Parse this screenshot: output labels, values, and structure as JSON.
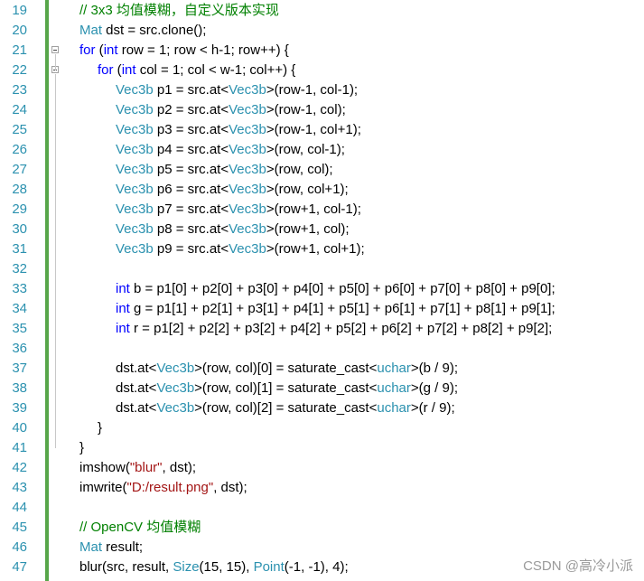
{
  "editor": {
    "watermark": "CSDN @高冷小派",
    "colors": {
      "line_number": "#2b91af",
      "keyword": "#0000ff",
      "type": "#2b91af",
      "comment": "#008000",
      "string": "#a31515",
      "change_bar": "#57a64a"
    },
    "lines": [
      {
        "n": "19",
        "indent": 1,
        "tokens": [
          [
            "cm",
            "// 3x3 均值模糊，自定义版本实现"
          ]
        ]
      },
      {
        "n": "20",
        "indent": 1,
        "tokens": [
          [
            "ty",
            "Mat"
          ],
          [
            "tx",
            " dst = src.clone();"
          ]
        ]
      },
      {
        "n": "21",
        "indent": 1,
        "fold": true,
        "tokens": [
          [
            "kw",
            "for"
          ],
          [
            "tx",
            " ("
          ],
          [
            "kw",
            "int"
          ],
          [
            "tx",
            " row = 1; row < h-1; row++) {"
          ]
        ]
      },
      {
        "n": "22",
        "indent": 2,
        "fold": true,
        "tokens": [
          [
            "kw",
            "for"
          ],
          [
            "tx",
            " ("
          ],
          [
            "kw",
            "int"
          ],
          [
            "tx",
            " col = 1; col < w-1; col++) {"
          ]
        ]
      },
      {
        "n": "23",
        "indent": 3,
        "tokens": [
          [
            "ty",
            "Vec3b"
          ],
          [
            "tx",
            " p1 = src.at<"
          ],
          [
            "ty",
            "Vec3b"
          ],
          [
            "tx",
            ">(row-1, col-1);"
          ]
        ]
      },
      {
        "n": "24",
        "indent": 3,
        "tokens": [
          [
            "ty",
            "Vec3b"
          ],
          [
            "tx",
            " p2 = src.at<"
          ],
          [
            "ty",
            "Vec3b"
          ],
          [
            "tx",
            ">(row-1, col);"
          ]
        ]
      },
      {
        "n": "25",
        "indent": 3,
        "tokens": [
          [
            "ty",
            "Vec3b"
          ],
          [
            "tx",
            " p3 = src.at<"
          ],
          [
            "ty",
            "Vec3b"
          ],
          [
            "tx",
            ">(row-1, col+1);"
          ]
        ]
      },
      {
        "n": "26",
        "indent": 3,
        "tokens": [
          [
            "ty",
            "Vec3b"
          ],
          [
            "tx",
            " p4 = src.at<"
          ],
          [
            "ty",
            "Vec3b"
          ],
          [
            "tx",
            ">(row, col-1);"
          ]
        ]
      },
      {
        "n": "27",
        "indent": 3,
        "tokens": [
          [
            "ty",
            "Vec3b"
          ],
          [
            "tx",
            " p5 = src.at<"
          ],
          [
            "ty",
            "Vec3b"
          ],
          [
            "tx",
            ">(row, col);"
          ]
        ]
      },
      {
        "n": "28",
        "indent": 3,
        "tokens": [
          [
            "ty",
            "Vec3b"
          ],
          [
            "tx",
            " p6 = src.at<"
          ],
          [
            "ty",
            "Vec3b"
          ],
          [
            "tx",
            ">(row, col+1);"
          ]
        ]
      },
      {
        "n": "29",
        "indent": 3,
        "tokens": [
          [
            "ty",
            "Vec3b"
          ],
          [
            "tx",
            " p7 = src.at<"
          ],
          [
            "ty",
            "Vec3b"
          ],
          [
            "tx",
            ">(row+1, col-1);"
          ]
        ]
      },
      {
        "n": "30",
        "indent": 3,
        "tokens": [
          [
            "ty",
            "Vec3b"
          ],
          [
            "tx",
            " p8 = src.at<"
          ],
          [
            "ty",
            "Vec3b"
          ],
          [
            "tx",
            ">(row+1, col);"
          ]
        ]
      },
      {
        "n": "31",
        "indent": 3,
        "tokens": [
          [
            "ty",
            "Vec3b"
          ],
          [
            "tx",
            " p9 = src.at<"
          ],
          [
            "ty",
            "Vec3b"
          ],
          [
            "tx",
            ">(row+1, col+1);"
          ]
        ]
      },
      {
        "n": "32",
        "indent": 0,
        "tokens": []
      },
      {
        "n": "33",
        "indent": 3,
        "tokens": [
          [
            "kw",
            "int"
          ],
          [
            "tx",
            " b = p1[0] + p2[0] + p3[0] + p4[0] + p5[0] + p6[0] + p7[0] + p8[0] + p9[0];"
          ]
        ]
      },
      {
        "n": "34",
        "indent": 3,
        "tokens": [
          [
            "kw",
            "int"
          ],
          [
            "tx",
            " g = p1[1] + p2[1] + p3[1] + p4[1] + p5[1] + p6[1] + p7[1] + p8[1] + p9[1];"
          ]
        ]
      },
      {
        "n": "35",
        "indent": 3,
        "tokens": [
          [
            "kw",
            "int"
          ],
          [
            "tx",
            " r = p1[2] + p2[2] + p3[2] + p4[2] + p5[2] + p6[2] + p7[2] + p8[2] + p9[2];"
          ]
        ]
      },
      {
        "n": "36",
        "indent": 0,
        "tokens": []
      },
      {
        "n": "37",
        "indent": 3,
        "tokens": [
          [
            "tx",
            "dst.at<"
          ],
          [
            "ty",
            "Vec3b"
          ],
          [
            "tx",
            ">(row, col)[0] = saturate_cast<"
          ],
          [
            "ty",
            "uchar"
          ],
          [
            "tx",
            ">(b / 9);"
          ]
        ]
      },
      {
        "n": "38",
        "indent": 3,
        "tokens": [
          [
            "tx",
            "dst.at<"
          ],
          [
            "ty",
            "Vec3b"
          ],
          [
            "tx",
            ">(row, col)[1] = saturate_cast<"
          ],
          [
            "ty",
            "uchar"
          ],
          [
            "tx",
            ">(g / 9);"
          ]
        ]
      },
      {
        "n": "39",
        "indent": 3,
        "tokens": [
          [
            "tx",
            "dst.at<"
          ],
          [
            "ty",
            "Vec3b"
          ],
          [
            "tx",
            ">(row, col)[2] = saturate_cast<"
          ],
          [
            "ty",
            "uchar"
          ],
          [
            "tx",
            ">(r / 9);"
          ]
        ]
      },
      {
        "n": "40",
        "indent": 2,
        "tokens": [
          [
            "tx",
            "}"
          ]
        ]
      },
      {
        "n": "41",
        "indent": 1,
        "tokens": [
          [
            "tx",
            "}"
          ]
        ]
      },
      {
        "n": "42",
        "indent": 1,
        "tokens": [
          [
            "tx",
            "imshow("
          ],
          [
            "st",
            "\"blur\""
          ],
          [
            "tx",
            ", dst);"
          ]
        ]
      },
      {
        "n": "43",
        "indent": 1,
        "tokens": [
          [
            "tx",
            "imwrite("
          ],
          [
            "st",
            "\"D:/result.png\""
          ],
          [
            "tx",
            ", dst);"
          ]
        ]
      },
      {
        "n": "44",
        "indent": 0,
        "tokens": []
      },
      {
        "n": "45",
        "indent": 1,
        "tokens": [
          [
            "cm",
            "// OpenCV 均值模糊"
          ]
        ]
      },
      {
        "n": "46",
        "indent": 1,
        "tokens": [
          [
            "ty",
            "Mat"
          ],
          [
            "tx",
            " result;"
          ]
        ]
      },
      {
        "n": "47",
        "indent": 1,
        "tokens": [
          [
            "tx",
            "blur(src, result, "
          ],
          [
            "ty",
            "Size"
          ],
          [
            "tx",
            "(15, 15), "
          ],
          [
            "ty",
            "Point"
          ],
          [
            "tx",
            "(-1, -1), 4);"
          ]
        ]
      }
    ]
  }
}
